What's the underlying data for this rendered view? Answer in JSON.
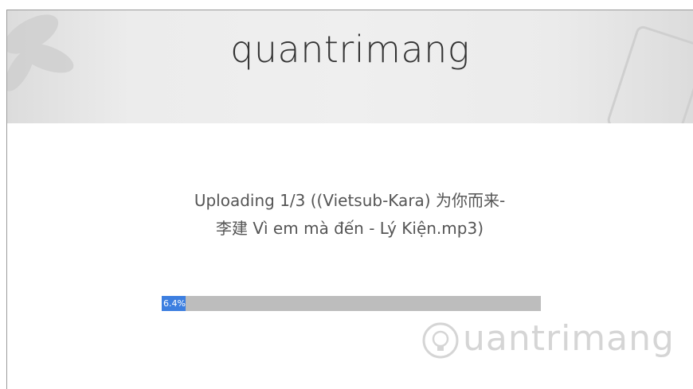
{
  "site": {
    "title": "quantrimang"
  },
  "upload": {
    "status_line1": "Uploading 1/3 ((Vietsub-Kara) 为你而来-",
    "status_line2": "李建 Vì em mà đến - Lý Kiện.mp3)",
    "progress_label": "6.4%",
    "progress_fraction": 0.064
  },
  "watermark": {
    "text": "uantrimang",
    "icon": "lightbulb-icon"
  },
  "colors": {
    "progress_fill": "#3d7fe0",
    "progress_track": "#bdbdbd"
  }
}
